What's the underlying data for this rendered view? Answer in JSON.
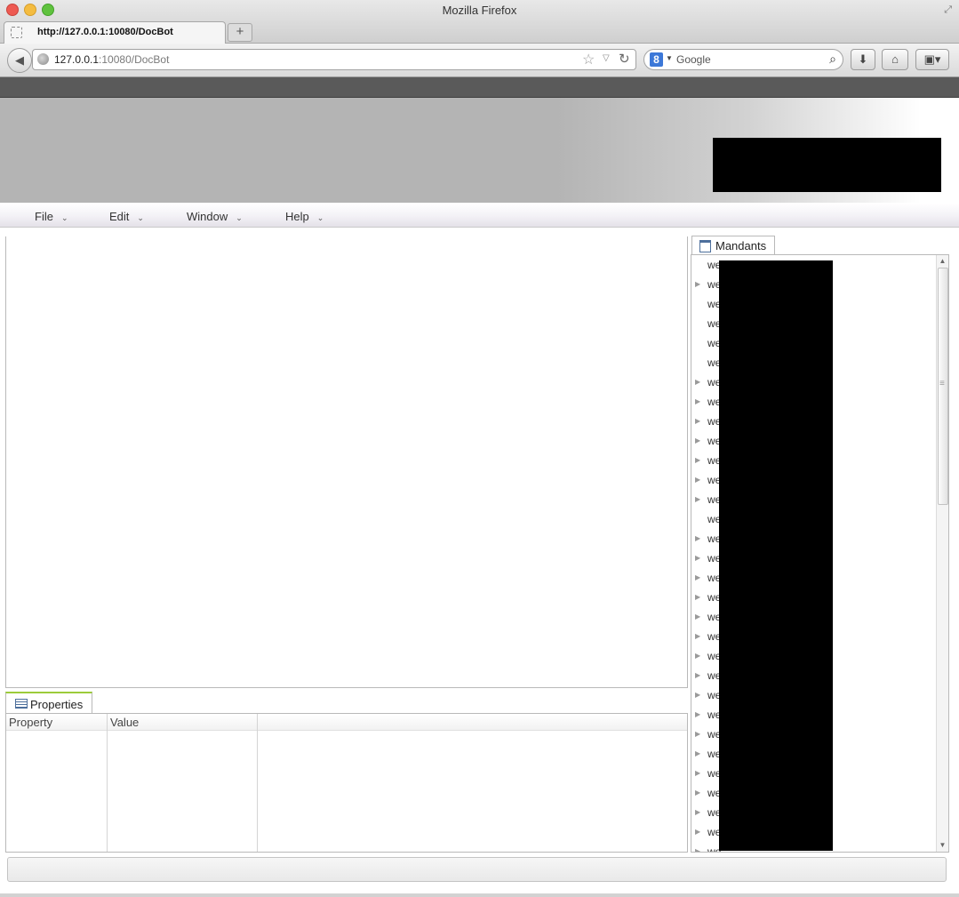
{
  "window": {
    "title": "Mozilla Firefox"
  },
  "tab": {
    "label": "http://127.0.0.1:10080/DocBot"
  },
  "url": {
    "host": "127.0.0.1",
    "rest": ":10080/DocBot"
  },
  "search": {
    "placeholder": "Google",
    "engine_letter": "8"
  },
  "menu": {
    "file": "File",
    "edit": "Edit",
    "window": "Window",
    "help": "Help"
  },
  "properties": {
    "tab": "Properties",
    "col_property": "Property",
    "col_value": "Value"
  },
  "mandants": {
    "tab": "Mandants",
    "rows": [
      {
        "label": "we",
        "expandable": false
      },
      {
        "label": "we",
        "expandable": true
      },
      {
        "label": "we",
        "expandable": false
      },
      {
        "label": "we",
        "expandable": false
      },
      {
        "label": "we",
        "expandable": false
      },
      {
        "label": "we",
        "expandable": false
      },
      {
        "label": "we",
        "expandable": true
      },
      {
        "label": "we",
        "expandable": true
      },
      {
        "label": "we",
        "expandable": true
      },
      {
        "label": "we",
        "expandable": true
      },
      {
        "label": "we",
        "expandable": true
      },
      {
        "label": "we",
        "expandable": true
      },
      {
        "label": "we",
        "expandable": true
      },
      {
        "label": "we",
        "expandable": false
      },
      {
        "label": "we",
        "expandable": true
      },
      {
        "label": "we",
        "expandable": true
      },
      {
        "label": "we",
        "expandable": true
      },
      {
        "label": "we",
        "expandable": true
      },
      {
        "label": "we",
        "expandable": true
      },
      {
        "label": "we",
        "expandable": true
      },
      {
        "label": "we",
        "expandable": true
      },
      {
        "label": "we",
        "expandable": true
      },
      {
        "label": "we",
        "expandable": true
      },
      {
        "label": "we",
        "expandable": true
      },
      {
        "label": "we",
        "expandable": true
      },
      {
        "label": "we",
        "expandable": true
      },
      {
        "label": "we",
        "expandable": true
      },
      {
        "label": "we",
        "expandable": true
      },
      {
        "label": "we",
        "expandable": true
      },
      {
        "label": "we",
        "expandable": true
      },
      {
        "label": "we",
        "expandable": true
      }
    ]
  }
}
